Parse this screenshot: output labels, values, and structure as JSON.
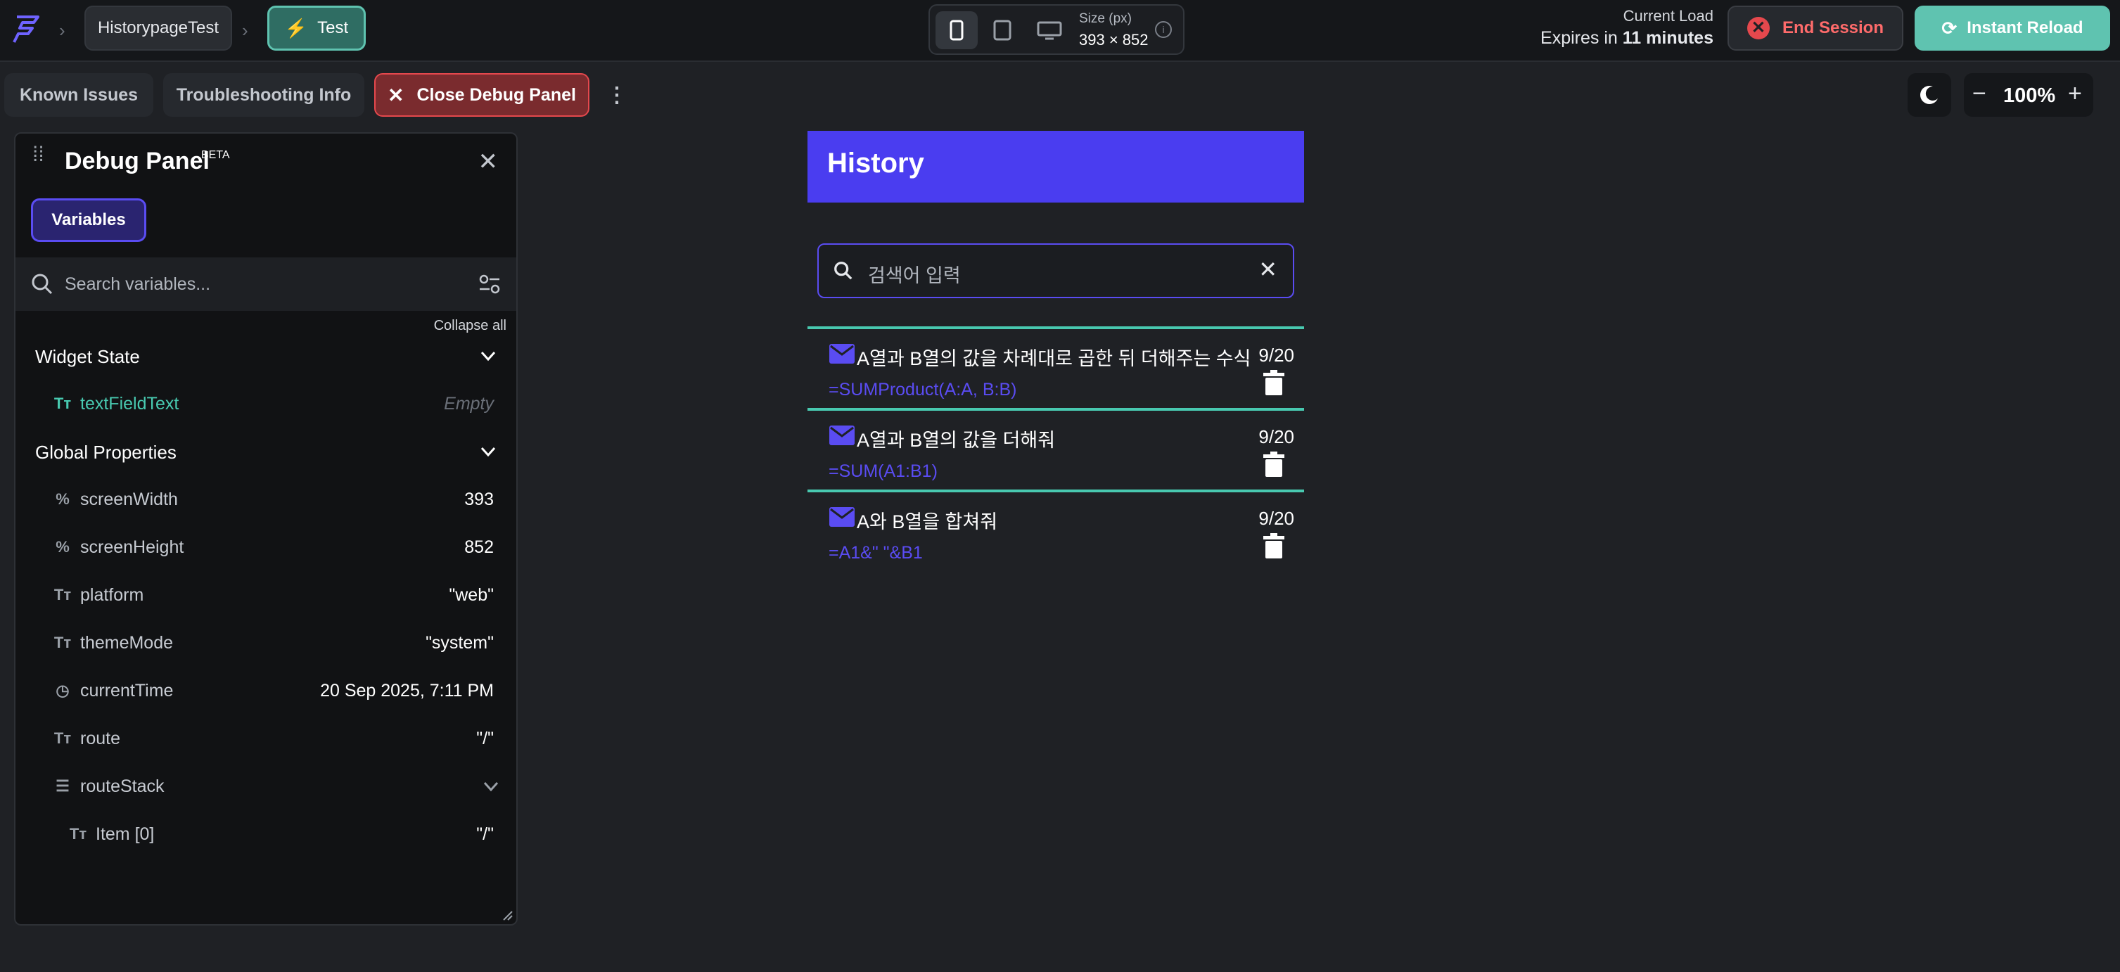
{
  "topbar": {
    "project_name": "HistorypageTest",
    "test_label": "Test",
    "size_label": "Size (px)",
    "size_value": "393 × 852",
    "current_load": "Current Load",
    "expires_prefix": "Expires in",
    "expires_value": "11 minutes",
    "end_session": "End Session",
    "instant_reload": "Instant Reload"
  },
  "toolbar": {
    "known_issues": "Known Issues",
    "troubleshooting": "Troubleshooting Info",
    "close_debug": "Close Debug Panel",
    "zoom": "100%"
  },
  "debug_panel": {
    "title": "Debug Panel",
    "beta": "BETA",
    "variables_tab": "Variables",
    "search_placeholder": "Search variables...",
    "collapse_all": "Collapse all",
    "widget_state": {
      "header": "Widget State",
      "items": [
        {
          "name": "textFieldText",
          "value": "Empty"
        }
      ]
    },
    "global_properties": {
      "header": "Global Properties",
      "items": [
        {
          "name": "screenWidth",
          "value": "393",
          "icon": "percent-icon"
        },
        {
          "name": "screenHeight",
          "value": "852",
          "icon": "percent-icon"
        },
        {
          "name": "platform",
          "value": "\"web\"",
          "icon": "text-type-icon"
        },
        {
          "name": "themeMode",
          "value": "\"system\"",
          "icon": "text-type-icon"
        },
        {
          "name": "currentTime",
          "value": "20 Sep 2025, 7:11 PM",
          "icon": "clock-icon"
        },
        {
          "name": "route",
          "value": "\"/\"",
          "icon": "text-type-icon"
        },
        {
          "name": "routeStack",
          "value": "",
          "icon": "list-icon"
        },
        {
          "name": "Item [0]",
          "value": "\"/\"",
          "icon": "text-type-icon"
        }
      ]
    }
  },
  "app": {
    "title": "History",
    "search_placeholder": "검색어 입력",
    "history": [
      {
        "title": "A열과 B열의 값을 차례대로 곱한 뒤 더해주는 수식",
        "formula": "=SUMProduct(A:A, B:B)",
        "date": "9/20"
      },
      {
        "title": "A열과 B열의 값을 더해줘",
        "formula": "=SUM(A1:B1)",
        "date": "9/20"
      },
      {
        "title": "A와 B열을 합쳐줘",
        "formula": "=A1&\" \"&B1",
        "date": "9/20"
      }
    ]
  },
  "colors": {
    "accent": "#4a3df0",
    "teal": "#48c9b0",
    "danger": "#e5484d",
    "reload": "#5fc3b0"
  }
}
